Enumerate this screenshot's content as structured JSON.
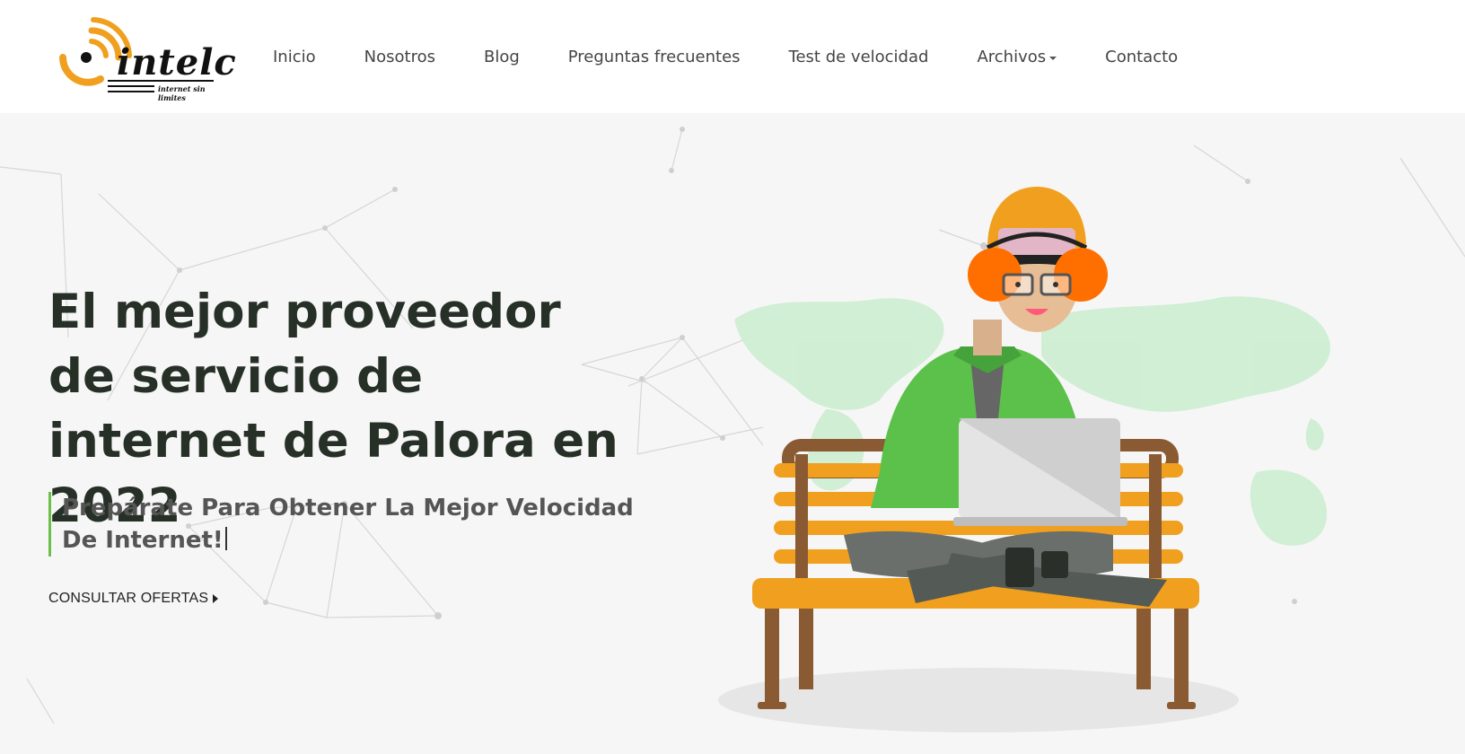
{
  "header": {
    "logo": {
      "name": "intelc",
      "tagline": "internet sin limites"
    },
    "nav": [
      {
        "label": "Inicio"
      },
      {
        "label": "Nosotros"
      },
      {
        "label": "Blog"
      },
      {
        "label": "Preguntas frecuentes"
      },
      {
        "label": "Test de velocidad"
      },
      {
        "label": "Archivos",
        "has_dropdown": true
      },
      {
        "label": "Contacto"
      }
    ]
  },
  "hero": {
    "title": "El mejor proveedor de servicio de internet de Palora en 2022",
    "subtitle": "Prepárate Para Obtener La Mejor Velocidad De Internet!",
    "cta_label": "CONSULTAR OFERTAS"
  },
  "colors": {
    "accent_orange": "#f0a01e",
    "accent_green": "#6cc04a",
    "title": "#263027",
    "background": "#f6f6f6"
  }
}
